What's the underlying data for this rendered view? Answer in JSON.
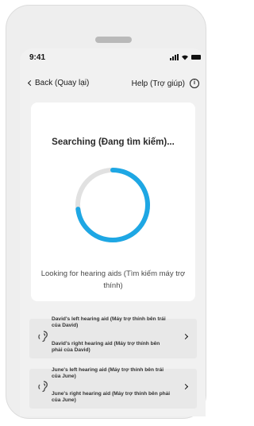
{
  "status_bar": {
    "time": "9:41"
  },
  "nav": {
    "back_label": "Back (Quay lại)",
    "help_label": "Help (Trợ giúp)",
    "info_icon": "info-icon"
  },
  "search_card": {
    "title": "Searching (Đang tìm kiếm)...",
    "subtitle": "Looking for hearing aids (Tìm kiếm máy trợ thính)",
    "spinner_color": "#1ea7e4",
    "spinner_track_color": "#e1e1e1",
    "spinner_progress": 0.73
  },
  "devices": [
    {
      "left_label": "David's left hearing aid (Máy trợ thính bên trái của David)",
      "right_label": "David's right hearing aid (Máy trợ thính bên phải của David)"
    },
    {
      "left_label": "June's left hearing aid (Máy trợ thính bên trái của June)",
      "right_label": "June's right hearing aid (Máy trợ thính bên phải của June)"
    }
  ]
}
